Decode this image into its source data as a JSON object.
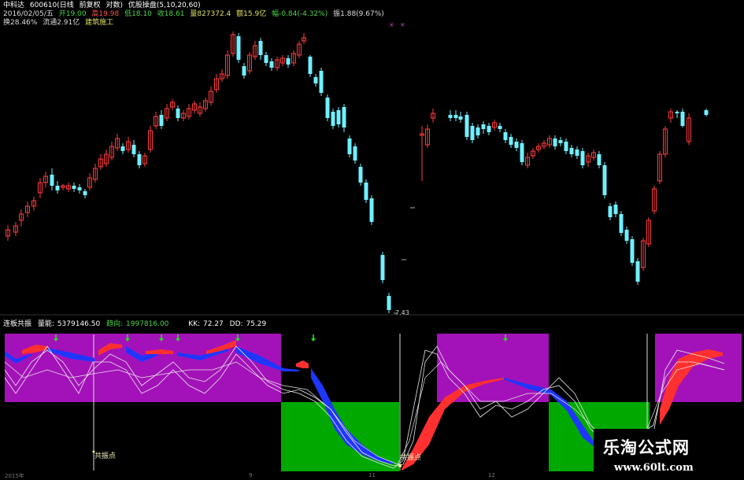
{
  "info_bar": {
    "line1": {
      "name": "中科达",
      "code": "600610(日线",
      "adjust": "前复权",
      "scale": "对数)",
      "indicator": "优股操盘(5,10,20,60)"
    },
    "line2": {
      "date": "2016/02/05/五",
      "open": "开19.00",
      "high": "高19.98",
      "low": "低18.10",
      "close": "收18.61",
      "volume": "量827372.4",
      "amount": "额15.9亿",
      "change": "幅-0.84(-4.32%)",
      "amplitude": "振1.88(9.67%)",
      "turnover": "换28.46%",
      "float": "流通2.91亿",
      "sector": "建筑施工"
    }
  },
  "price_chart": {
    "low_price_label": "7.43",
    "colors": {
      "up": "#ff3c3c",
      "down": "#6ff0ff",
      "background": "#000000"
    }
  },
  "indicator_panel": {
    "name": "连板共振",
    "mainforce_label": "量能:",
    "mainforce_value": "5379146.50",
    "trend_label": "趋向:",
    "trend_value": "1997816.00",
    "kk_label": "KK:",
    "kk_value": "72.27",
    "dd_label": "DD:",
    "dd_value": "75.29",
    "resonance_label_1": "共振点",
    "resonance_label_2": "共振点",
    "colors": {
      "zone_high": "#a312b8",
      "zone_low": "#00a800",
      "ribbon_up": "#ff3030",
      "ribbon_down": "#1f36ff",
      "arrow": "#20e020"
    }
  },
  "axis": {
    "ticks": [
      "2015年",
      "9",
      "11",
      "12"
    ]
  },
  "watermark": {
    "title": "乐淘公式网",
    "url": "www.60lt.com"
  }
}
